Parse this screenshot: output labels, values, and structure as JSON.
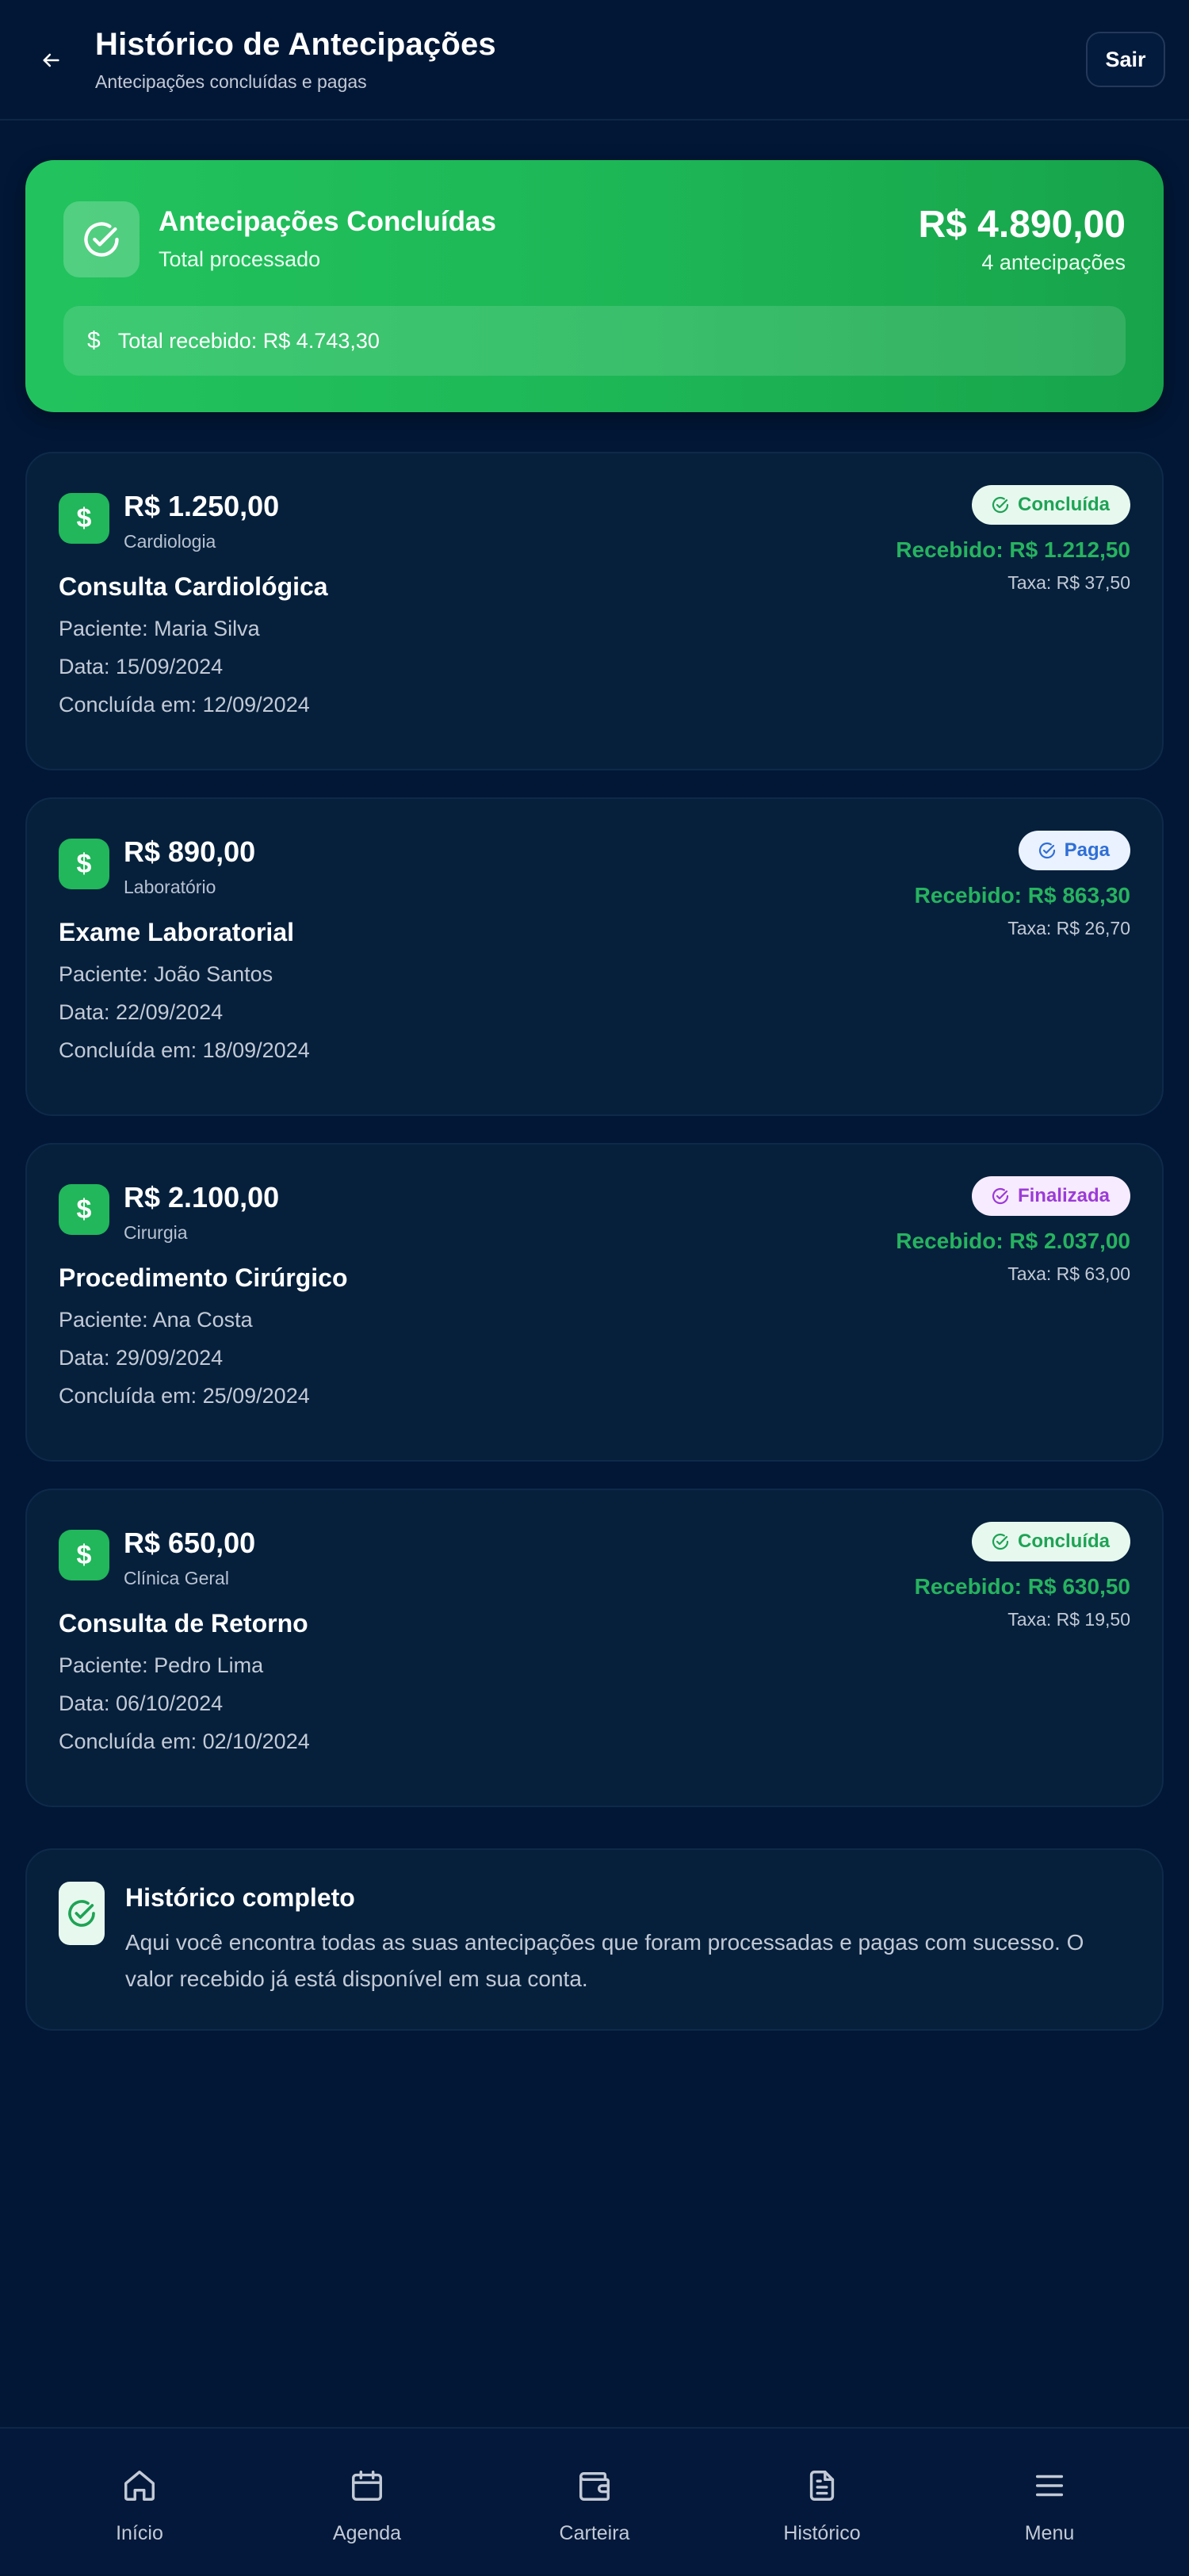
{
  "header": {
    "title": "Histórico de Antecipações",
    "subtitle": "Antecipações concluídas e pagas",
    "logout_label": "Sair"
  },
  "summary": {
    "title": "Antecipações Concluídas",
    "subtitle": "Total processado",
    "total": "R$ 4.890,00",
    "count": "4 antecipações",
    "received": "Total recebido: R$ 4.743,30"
  },
  "cards": [
    {
      "amount": "R$ 1.250,00",
      "category": "Cardiologia",
      "title": "Consulta Cardiológica",
      "patient": "Paciente: Maria Silva",
      "date": "Data: 15/09/2024",
      "completed": "Concluída em: 12/09/2024",
      "status": "Concluída",
      "received": "Recebido: R$ 1.212,50",
      "fee": "Taxa: R$ 37,50"
    },
    {
      "amount": "R$ 890,00",
      "category": "Laboratório",
      "title": "Exame Laboratorial",
      "patient": "Paciente: João Santos",
      "date": "Data: 22/09/2024",
      "completed": "Concluída em: 18/09/2024",
      "status": "Paga",
      "received": "Recebido: R$ 863,30",
      "fee": "Taxa: R$ 26,70"
    },
    {
      "amount": "R$ 2.100,00",
      "category": "Cirurgia",
      "title": "Procedimento Cirúrgico",
      "patient": "Paciente: Ana Costa",
      "date": "Data: 29/09/2024",
      "completed": "Concluída em: 25/09/2024",
      "status": "Finalizada",
      "received": "Recebido: R$ 2.037,00",
      "fee": "Taxa: R$ 63,00"
    },
    {
      "amount": "R$ 650,00",
      "category": "Clínica Geral",
      "title": "Consulta de Retorno",
      "patient": "Paciente: Pedro Lima",
      "date": "Data: 06/10/2024",
      "completed": "Concluída em: 02/10/2024",
      "status": "Concluída",
      "received": "Recebido: R$ 630,50",
      "fee": "Taxa: R$ 19,50"
    }
  ],
  "info": {
    "title": "Histórico completo",
    "text": "Aqui você encontra todas as suas antecipações que foram processadas e pagas com sucesso. O valor recebido já está disponível em sua conta."
  },
  "nav": {
    "items": [
      {
        "label": "Início",
        "icon": "home-icon"
      },
      {
        "label": "Agenda",
        "icon": "calendar-icon"
      },
      {
        "label": "Carteira",
        "icon": "wallet-icon"
      },
      {
        "label": "Histórico",
        "icon": "document-icon"
      },
      {
        "label": "Menu",
        "icon": "menu-icon"
      }
    ]
  },
  "colors": {
    "background": "#021736",
    "accent_green": "#22c35e",
    "received_green": "#27b35f",
    "paga_blue": "#2f6fd6",
    "finalizada_purple": "#9c3bd6"
  }
}
